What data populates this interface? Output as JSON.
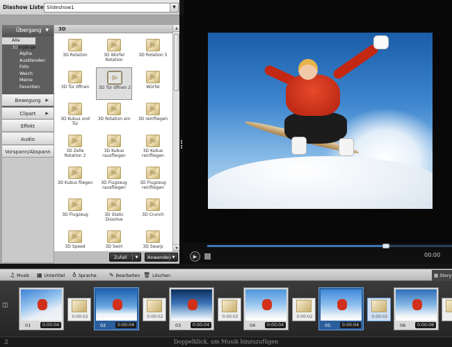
{
  "header": {
    "title": "Diashow Liste",
    "slideshow_select": "Slideshow1"
  },
  "sidebar": {
    "category_header": "Übergang",
    "subcategories": [
      "Alle Übergänge",
      "3D",
      "Alpha",
      "Ausblenden",
      "Foto",
      "Weich",
      "Meine Favoriten"
    ],
    "buttons": [
      {
        "label": "Bewegung",
        "has_arrow": true
      },
      {
        "label": "Clipart",
        "has_arrow": true
      },
      {
        "label": "Effekt",
        "has_arrow": false
      },
      {
        "label": "Audio",
        "has_arrow": false
      },
      {
        "label": "Vorspann/Abspann",
        "has_arrow": false
      }
    ]
  },
  "grid": {
    "header": "3D",
    "items": [
      "3D Rotation",
      "3D Würfel Rotation",
      "3D Rotation 5",
      "3D Tür öffnen",
      "3D Tür öffnen 2",
      "Würfel",
      "3D Kubus und Tür",
      "3D Rotation ein",
      "3D reinfliegen",
      "3D Zelle Rotation 2",
      "3D Kubus rausfliegen",
      "3D Kubus reinfliegen",
      "3D Kubus fliegen",
      "3D Flugzeug rausfliegen",
      "3D Flugzeug reinfliegen",
      "3D Flugzeug",
      "3D Static Dissolve",
      "3D Crunch",
      "3D Speed",
      "3D Swirl",
      "3D Swarp"
    ],
    "selected_index": 4,
    "random_button": "Zufall",
    "apply_button": "Anwenden"
  },
  "preview": {
    "progress": 0.747,
    "timecode": "00:00"
  },
  "timeline_toolbar": {
    "music": "Musik",
    "subtitle": "Untertitel",
    "voice": "Sprache",
    "edit": "Bearbeiten",
    "delete": "Löschen",
    "storyboard_tab": "Story"
  },
  "timeline": {
    "slides": [
      {
        "num": "01",
        "duration": "0:00:04",
        "selected": false
      },
      {
        "num": "02",
        "duration": "0:00:04",
        "selected": true
      },
      {
        "num": "03",
        "duration": "0:00:04",
        "selected": false
      },
      {
        "num": "04",
        "duration": "0:00:04",
        "selected": false
      },
      {
        "num": "05",
        "duration": "0:00:04",
        "selected": true
      },
      {
        "num": "06",
        "duration": "0:00:06",
        "selected": false
      }
    ],
    "transitions": [
      {
        "duration": "0:00:02",
        "selected": false
      },
      {
        "duration": "0:00:02",
        "selected": false
      },
      {
        "duration": "0:00:02",
        "selected": false
      },
      {
        "duration": "0:00:02",
        "selected": false
      },
      {
        "duration": "0:00:02",
        "selected": true
      },
      {
        "duration": "",
        "selected": false
      }
    ],
    "music_hint": "Doppelklick, um Musik hinzuzufügen"
  },
  "colors": {
    "accent_blue": "#2b5e9c",
    "selection_blue": "#6aa2dd"
  }
}
